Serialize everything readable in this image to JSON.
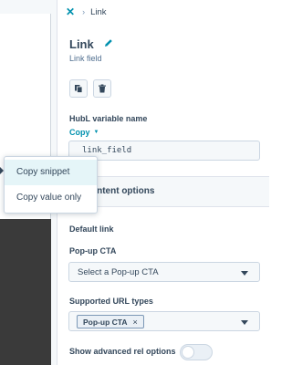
{
  "breadcrumb": {
    "current": "Link"
  },
  "module": {
    "title": "Link",
    "subtitle": "Link field"
  },
  "hubl": {
    "label": "HubL variable name",
    "copy_label": "Copy",
    "value": "link_field"
  },
  "section": {
    "title": "ontent options"
  },
  "default_link": {
    "label": "Default link"
  },
  "popup_cta": {
    "label": "Pop-up CTA",
    "placeholder": "Select a Pop-up CTA"
  },
  "url_types": {
    "label": "Supported URL types",
    "tag": "Pop-up CTA",
    "tag_remove": "×"
  },
  "advanced": {
    "label": "Show advanced rel options",
    "enabled": false
  },
  "copy_menu": {
    "items": [
      {
        "label": "Copy snippet"
      },
      {
        "label": "Copy value only"
      }
    ]
  },
  "icons": {
    "close": "close-icon",
    "edit": "pencil-icon",
    "clone": "copy-icon",
    "delete": "trash-icon"
  },
  "colors": {
    "accent": "#0091ae",
    "text": "#33475b",
    "border": "#cbd6e2",
    "input_bg": "#f5f8fa"
  }
}
